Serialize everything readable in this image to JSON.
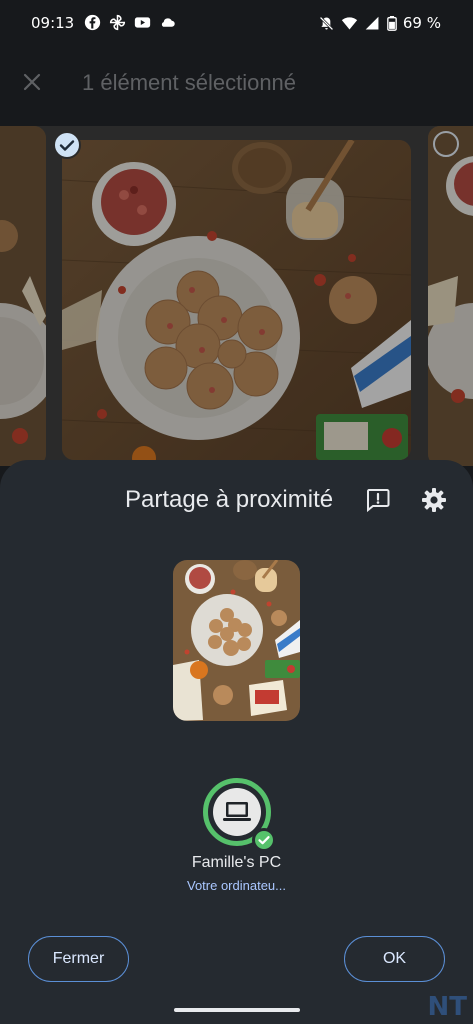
{
  "status_bar": {
    "time": "09:13",
    "battery": "69 %",
    "left_icons": [
      "facebook-icon",
      "pinwheel-icon",
      "youtube-icon",
      "cloud-icon"
    ],
    "right_icons": [
      "notifications-off-icon",
      "wifi-icon",
      "signal-icon",
      "battery-icon"
    ]
  },
  "selection": {
    "title": "1 élément sélectionné"
  },
  "share_sheet": {
    "title": "Partage à proximité",
    "device": {
      "name": "Famille's PC",
      "subtitle": "Votre ordinateu..."
    },
    "buttons": {
      "close": "Fermer",
      "ok": "OK"
    }
  },
  "watermark": "NT",
  "colors": {
    "sheet_bg": "#252a30",
    "accent_green": "#56c16b",
    "button_outline": "#5b8fd6",
    "subtitle_blue": "#aac7ff"
  }
}
